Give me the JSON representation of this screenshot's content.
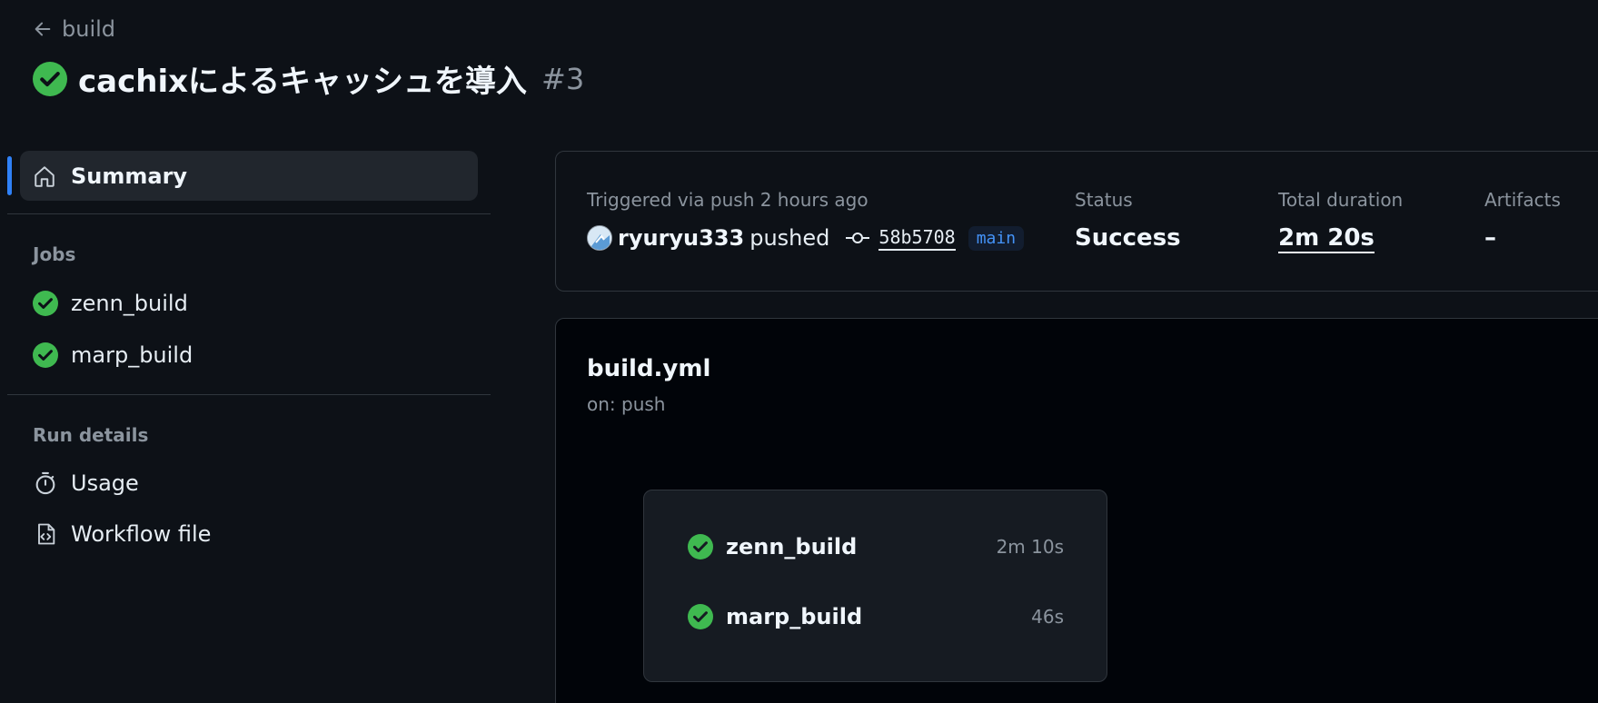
{
  "header": {
    "back_label": "build",
    "title": "cachixによるキャッシュを導入",
    "run_number": "#3"
  },
  "sidebar": {
    "summary_label": "Summary",
    "jobs_heading": "Jobs",
    "jobs": [
      {
        "label": "zenn_build",
        "status": "success"
      },
      {
        "label": "marp_build",
        "status": "success"
      }
    ],
    "run_details_heading": "Run details",
    "run_details": [
      {
        "label": "Usage",
        "icon": "stopwatch-icon"
      },
      {
        "label": "Workflow file",
        "icon": "file-code-icon"
      }
    ]
  },
  "summary": {
    "triggered_text": "Triggered via push 2 hours ago",
    "user": "ryuryu333",
    "pushed_word": "pushed",
    "commit_sha": "58b5708",
    "branch": "main",
    "status_label": "Status",
    "status_value": "Success",
    "duration_label": "Total duration",
    "duration_value": "2m 20s",
    "artifacts_label": "Artifacts",
    "artifacts_value": "–"
  },
  "workflow": {
    "file": "build.yml",
    "trigger": "on: push",
    "jobs": [
      {
        "name": "zenn_build",
        "duration": "2m 10s"
      },
      {
        "name": "marp_build",
        "duration": "46s"
      }
    ]
  },
  "colors": {
    "background": "#0d1117",
    "success": "#3fb950",
    "accent": "#2f81f7",
    "muted": "#8b949e"
  }
}
